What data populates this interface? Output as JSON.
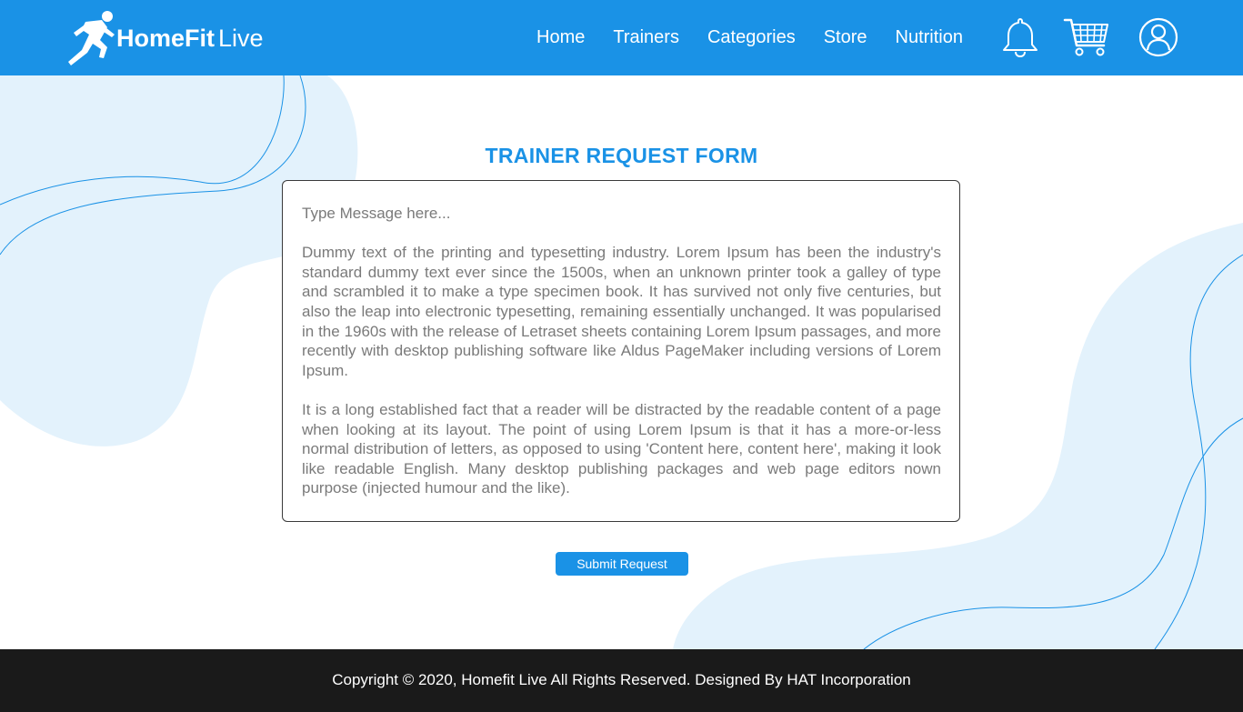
{
  "colors": {
    "primary": "#1a92e6",
    "blob_fill": "#e3f2fc",
    "footer_bg": "#1a1a1a",
    "text_gray": "#7a7a7a"
  },
  "header": {
    "logo": {
      "brand": "HomeFit",
      "brand_sub": "Live",
      "icon": "running-man-icon"
    },
    "nav": [
      {
        "label": "Home"
      },
      {
        "label": "Trainers"
      },
      {
        "label": "Categories"
      },
      {
        "label": "Store"
      },
      {
        "label": "Nutrition"
      }
    ],
    "icons": [
      "bell-icon",
      "cart-icon",
      "user-profile-icon"
    ]
  },
  "form": {
    "title": "TRAINER REQUEST FORM",
    "message": {
      "placeholder": "Type Message here...",
      "paragraphs": [
        "Dummy text of the printing and typesetting industry. Lorem Ipsum has been the industry's standard dummy text ever since the 1500s, when an unknown printer took a galley of type and scrambled it to make a type specimen book. It has survived not only five centuries, but also the leap into electronic typesetting, remaining essentially unchanged. It was popularised in the 1960s with the release of Letraset sheets containing Lorem Ipsum passages, and more recently with desktop publishing software like Aldus PageMaker including versions of Lorem Ipsum.",
        "It is a long established fact that a reader will be distracted by the readable content of a page when looking at its layout. The point of using Lorem Ipsum is that it has a more-or-less normal distribution of letters, as opposed to using 'Content here, content here', making it look like readable English. Many desktop publishing packages and web page editors nown purpose (injected humour and the like)."
      ]
    },
    "submit_label": "Submit Request"
  },
  "footer": {
    "text": "Copyright © 2020, Homefit Live All Rights Reserved. Designed By HAT Incorporation"
  }
}
